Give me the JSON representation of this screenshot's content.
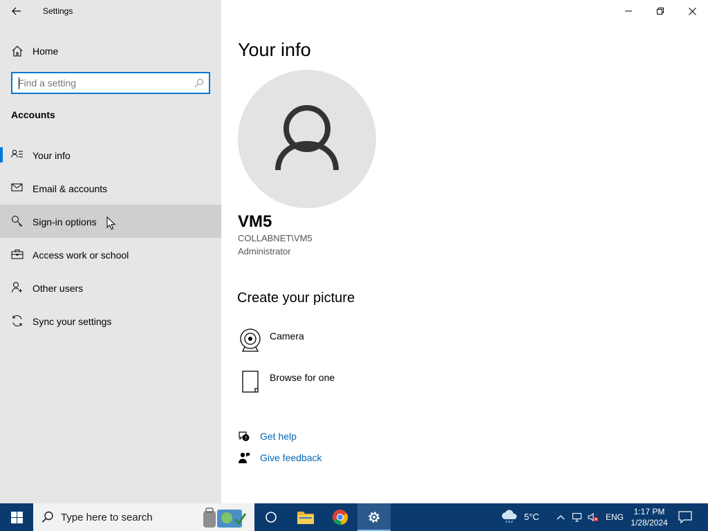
{
  "window": {
    "title": "Settings"
  },
  "sidebar": {
    "home_label": "Home",
    "search_placeholder": "Find a setting",
    "section": "Accounts",
    "items": [
      {
        "label": "Your info",
        "icon": "person-list-icon",
        "selected": true
      },
      {
        "label": "Email & accounts",
        "icon": "mail-icon"
      },
      {
        "label": "Sign-in options",
        "icon": "key-icon",
        "hover": true
      },
      {
        "label": "Access work or school",
        "icon": "briefcase-icon"
      },
      {
        "label": "Other users",
        "icon": "person-add-icon"
      },
      {
        "label": "Sync your settings",
        "icon": "sync-icon"
      }
    ]
  },
  "main": {
    "title": "Your info",
    "user": {
      "name": "VM5",
      "domain": "COLLABNET\\VM5",
      "role": "Administrator"
    },
    "create_picture": {
      "heading": "Create your picture",
      "options": [
        {
          "label": "Camera",
          "icon": "camera-icon"
        },
        {
          "label": "Browse for one",
          "icon": "document-icon"
        }
      ]
    },
    "links": [
      {
        "label": "Get help",
        "icon": "help-chat-icon"
      },
      {
        "label": "Give feedback",
        "icon": "feedback-icon"
      }
    ]
  },
  "taskbar": {
    "search_placeholder": "Type here to search",
    "weather_temp": "5°C",
    "language": "ENG",
    "time": "1:17 PM",
    "date": "1/28/2024"
  },
  "colors": {
    "accent": "#0078d7",
    "link": "#0067b8",
    "sidebar_bg": "#e6e6e6",
    "taskbar_bg": "#0b3b6e"
  }
}
